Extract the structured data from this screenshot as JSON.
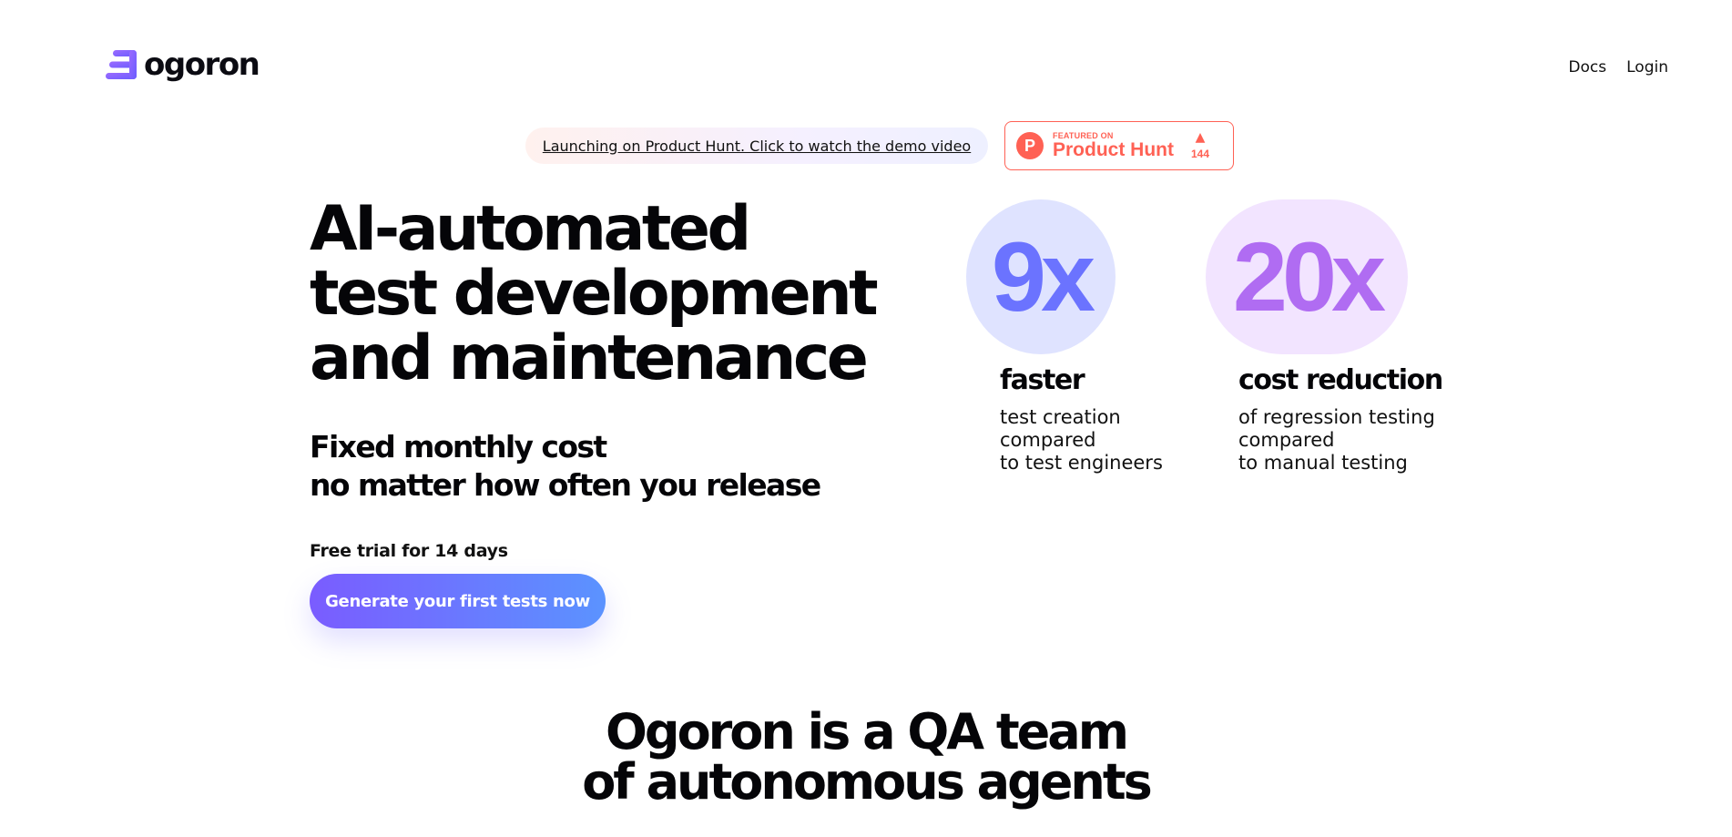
{
  "header": {
    "logo_text": "ogoron",
    "logo_icon": "ogoron-logo-icon",
    "nav": [
      {
        "label": "Docs"
      },
      {
        "label": "Login"
      }
    ]
  },
  "announcement": {
    "link_text": "Launching on Product Hunt. Click to watch the demo video"
  },
  "product_hunt_badge": {
    "logo_letter": "P",
    "featured_text": "FEATURED ON",
    "name": "Product Hunt",
    "upvote_icon": "triangle-up-icon",
    "votes": "144",
    "color": "#ff6154"
  },
  "hero": {
    "title_lines": [
      "AI-automated",
      "test development",
      "and maintenance"
    ],
    "subtitle_lines": [
      "Fixed monthly cost",
      "no matter how often you release"
    ],
    "trial_text": "Free trial for 14 days",
    "cta_label": "Generate your first tests now"
  },
  "stats": [
    {
      "value": "9x",
      "label": "faster",
      "desc_lines": [
        "test creation",
        "compared",
        "to test engineers"
      ],
      "color": "#6b73ff",
      "bg": "#dfe3ff"
    },
    {
      "value": "20x",
      "label": "cost reduction",
      "desc_lines": [
        "of regression testing",
        "compared",
        "to manual testing"
      ],
      "color": "#b06cf2",
      "bg": "#f2e4ff"
    }
  ],
  "section": {
    "title_lines": [
      "Ogoron is a QA team",
      "of autonomous agents"
    ]
  },
  "colors": {
    "cta_gradient_start": "#7a5cff",
    "cta_gradient_end": "#5b93ff",
    "text": "#050508"
  }
}
